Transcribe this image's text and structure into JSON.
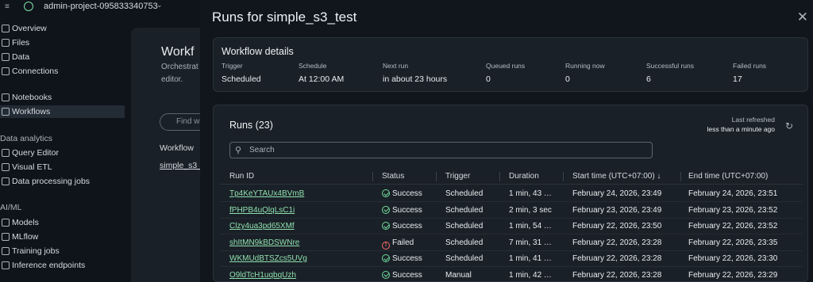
{
  "topbar": {
    "project": "admin-project-095833340753"
  },
  "sidebar": {
    "items": [
      {
        "label": "Overview"
      },
      {
        "label": "Files"
      },
      {
        "label": "Data"
      },
      {
        "label": "Connections"
      },
      {
        "label": "Notebooks"
      },
      {
        "label": "Workflows"
      }
    ],
    "groups": {
      "data_analytics": "Data analytics",
      "aiml": "AI/ML"
    },
    "analytics_items": [
      {
        "label": "Query Editor"
      },
      {
        "label": "Visual ETL"
      },
      {
        "label": "Data processing jobs"
      }
    ],
    "aiml_items": [
      {
        "label": "Models"
      },
      {
        "label": "MLflow"
      },
      {
        "label": "Training jobs"
      },
      {
        "label": "Inference endpoints"
      }
    ]
  },
  "background": {
    "title": "Workf",
    "sub1": "Orchestrat",
    "sub2": "editor.",
    "find_placeholder": "Find w",
    "col": "Workflow",
    "link": "simple_s3_"
  },
  "drawer": {
    "title": "Runs for simple_s3_test",
    "details": {
      "heading": "Workflow details",
      "fields": [
        {
          "k": "Trigger",
          "v": "Scheduled"
        },
        {
          "k": "Schedule",
          "v": "At 12:00 AM"
        },
        {
          "k": "Next run",
          "v": "in about 23 hours"
        },
        {
          "k": "Queued runs",
          "v": "0"
        },
        {
          "k": "Running now",
          "v": "0"
        },
        {
          "k": "Successful runs",
          "v": "6"
        },
        {
          "k": "Failed runs",
          "v": "17"
        }
      ]
    },
    "runs": {
      "heading": "Runs (23)",
      "last_refreshed_label": "Last refreshed",
      "last_refreshed_value": "less than a minute ago",
      "search_placeholder": "Search",
      "columns": [
        "Run ID",
        "Status",
        "Trigger",
        "Duration",
        "Start time (UTC+07:00) ↓",
        "End time (UTC+07:00)"
      ],
      "rows": [
        {
          "id": "Tp4KeYTAUx4BVmB",
          "status": "Success",
          "trigger": "Scheduled",
          "duration": "1 min, 43 …",
          "start": "February 24, 2026, 23:49",
          "end": "February 24, 2026, 23:51"
        },
        {
          "id": "fPHPB4uQlqLsC1i",
          "status": "Success",
          "trigger": "Scheduled",
          "duration": "2 min, 3 sec",
          "start": "February 23, 2026, 23:49",
          "end": "February 23, 2026, 23:52"
        },
        {
          "id": "Clzy4ua3pd65XMf",
          "status": "Success",
          "trigger": "Scheduled",
          "duration": "1 min, 54 …",
          "start": "February 22, 2026, 23:50",
          "end": "February 22, 2026, 23:52"
        },
        {
          "id": "shItMN9kBDSWNre",
          "status": "Failed",
          "trigger": "Scheduled",
          "duration": "7 min, 31 …",
          "start": "February 22, 2026, 23:28",
          "end": "February 22, 2026, 23:35"
        },
        {
          "id": "WKMUdBTSZcs5UVg",
          "status": "Success",
          "trigger": "Scheduled",
          "duration": "1 min, 41 …",
          "start": "February 22, 2026, 23:28",
          "end": "February 22, 2026, 23:30"
        },
        {
          "id": "O9ldTcH1uqbqUzh",
          "status": "Success",
          "trigger": "Manual",
          "duration": "1 min, 42 …",
          "start": "February 22, 2026, 23:28",
          "end": "February 22, 2026, 23:29"
        }
      ]
    }
  }
}
